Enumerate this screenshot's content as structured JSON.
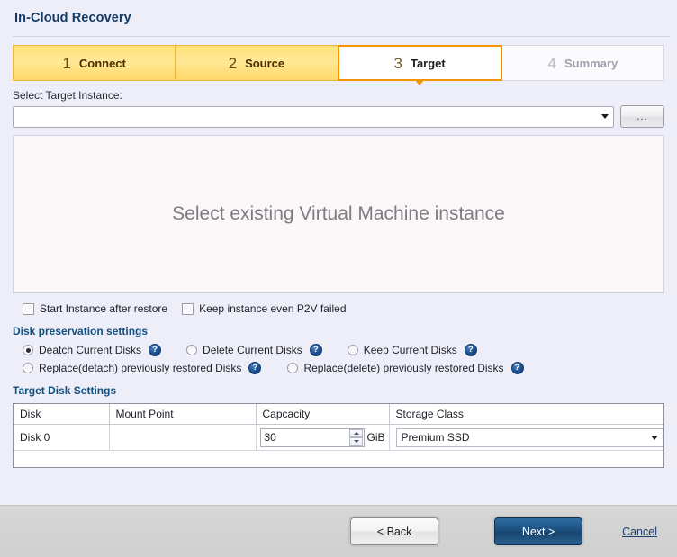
{
  "window": {
    "title": "In-Cloud Recovery"
  },
  "wizard": {
    "steps": [
      {
        "num": "1",
        "label": "Connect",
        "state": "done"
      },
      {
        "num": "2",
        "label": "Source",
        "state": "done"
      },
      {
        "num": "3",
        "label": "Target",
        "state": "current"
      },
      {
        "num": "4",
        "label": "Summary",
        "state": "upcoming"
      }
    ]
  },
  "target_instance": {
    "label": "Select Target Instance:",
    "value": "",
    "placeholder": "",
    "browse_button_label": "...",
    "dropdown_icon": "chevron-down-icon"
  },
  "preview": {
    "message": "Select existing Virtual Machine instance"
  },
  "checkboxes": [
    {
      "label": "Start Instance after restore",
      "checked": false
    },
    {
      "label": "Keep instance even P2V failed",
      "checked": false
    }
  ],
  "disk_preservation": {
    "title": "Disk preservation settings",
    "help_icon": "question-help-icon",
    "options_row1": [
      {
        "label": "Deatch Current Disks",
        "selected": true
      },
      {
        "label": "Delete Current Disks",
        "selected": false
      },
      {
        "label": "Keep Current Disks",
        "selected": false
      }
    ],
    "options_row2": [
      {
        "label": "Replace(detach) previously restored Disks",
        "selected": false
      },
      {
        "label": "Replace(delete) previously restored Disks",
        "selected": false
      }
    ]
  },
  "target_disk_settings": {
    "title": "Target Disk Settings",
    "columns": [
      "Disk",
      "Mount Point",
      "Capcacity",
      "Storage Class"
    ],
    "rows": [
      {
        "disk": "Disk 0",
        "mount_point": "",
        "capacity_value": "30",
        "capacity_unit": "GiB",
        "storage_class": "Premium SSD"
      }
    ]
  },
  "footer": {
    "back_label": "< Back",
    "next_label": "Next >",
    "cancel_label": "Cancel"
  },
  "colors": {
    "accent_orange": "#f29400",
    "tab_yellow": "#ffe07a",
    "title_blue": "#123a63",
    "section_blue": "#11507f",
    "next_button_blue": "#1d4f80",
    "page_background": "#eeeef9",
    "footer_gray": "#d4d4d4"
  }
}
